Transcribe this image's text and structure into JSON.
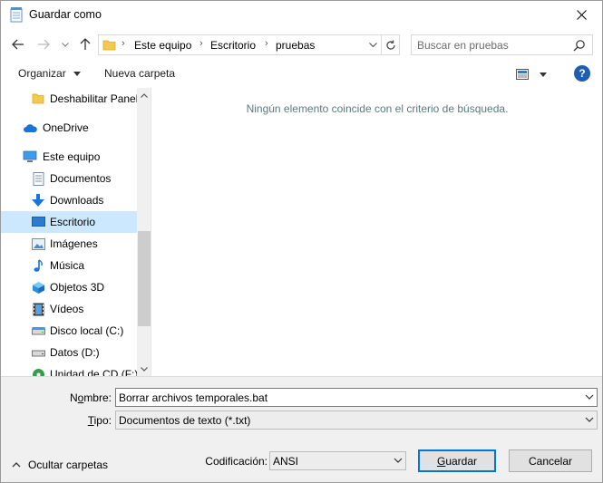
{
  "window": {
    "title": "Guardar como"
  },
  "address": {
    "crumbs": [
      "Este equipo",
      "Escritorio",
      "pruebas"
    ]
  },
  "search": {
    "placeholder": "Buscar en pruebas"
  },
  "toolbar": {
    "organize_label": "Organizar",
    "new_folder_label": "Nueva carpeta",
    "help_label": "?"
  },
  "sidebar": {
    "items": [
      {
        "label": "Deshabilitar Panel",
        "icon": "folder-icon"
      },
      {
        "label": "OneDrive",
        "icon": "cloud-icon"
      },
      {
        "label": "Este equipo",
        "icon": "computer-icon"
      },
      {
        "label": "Documentos",
        "icon": "documents-icon"
      },
      {
        "label": "Downloads",
        "icon": "download-icon"
      },
      {
        "label": "Escritorio",
        "icon": "desktop-icon",
        "selected": true
      },
      {
        "label": "Imágenes",
        "icon": "pictures-icon"
      },
      {
        "label": "Música",
        "icon": "music-icon"
      },
      {
        "label": "Objetos 3D",
        "icon": "cube-icon"
      },
      {
        "label": "Vídeos",
        "icon": "video-icon"
      },
      {
        "label": "Disco local (C:)",
        "icon": "drive-icon"
      },
      {
        "label": "Datos (D:)",
        "icon": "drive-icon"
      },
      {
        "label": "Unidad de CD (F:)",
        "icon": "cd-drive-icon"
      }
    ]
  },
  "content": {
    "empty_message": "Ningún elemento coincide con el criterio de búsqueda."
  },
  "form": {
    "filename_label_pre": "N",
    "filename_label_ul": "o",
    "filename_label_post": "mbre:",
    "filename_value": "Borrar archivos temporales.bat",
    "type_label_ul": "T",
    "type_label_post": "ipo:",
    "type_value": "Documentos de texto (*.txt)",
    "encoding_label": "Codificación:",
    "encoding_value": "ANSI"
  },
  "footer": {
    "hide_folders_label": "Ocultar carpetas",
    "save_label_ul": "G",
    "save_label_post": "uardar",
    "cancel_label": "Cancelar"
  },
  "colors": {
    "accent": "#0078d7",
    "selection": "#cce8ff",
    "help": "#1e5fb4"
  }
}
